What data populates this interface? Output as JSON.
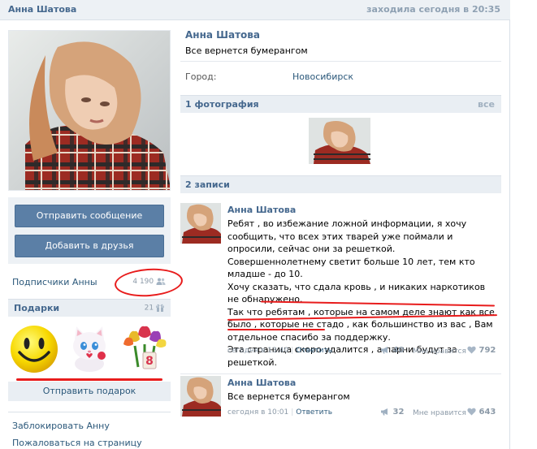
{
  "topbar": {
    "name": "Анна Шатова",
    "status": "заходила сегодня в 20:35"
  },
  "profile": {
    "name": "Анна Шатова",
    "status": "Все вернется бумерангом",
    "city_label": "Город:",
    "city_value": "Новосибирск"
  },
  "actions": {
    "send_message": "Отправить сообщение",
    "add_friend": "Добавить в друзья"
  },
  "followers": {
    "label": "Подписчики Анны",
    "count": "4 190"
  },
  "gifts": {
    "title": "Подарки",
    "count": "21",
    "send_gift": "Отправить подарок",
    "items": [
      "smiley-gift",
      "kitten-gift",
      "tulips-gift"
    ]
  },
  "links": {
    "block": "Заблокировать Анну",
    "report": "Пожаловаться на страницу"
  },
  "photos": {
    "title": "1 фотография",
    "all": "все"
  },
  "wall": {
    "title": "2 записи",
    "posts": [
      {
        "author": "Анна Шатова",
        "lines": [
          "Ребят , во избежание ложной информации, я хочу сообщить, что всех этих тварей уже поймали и опросили, сейчас они за решеткой. Совершеннолетнему светит больше 10 лет, тем кто младше - до 10.",
          "Хочу сказать, что сдала кровь , и никаких наркотиков не обнаружено.",
          "Так что ребятам , которые на самом деле знают как все было , которые не стадо , как большинство из вас , Вам отдельное спасибо за поддержку.",
          "Эта страница скоро удалится , а парни будут за решеткой."
        ],
        "time": "сегодня в 13:40",
        "reply": "Ответить",
        "shares": "40",
        "likes_label": "Мне нравится",
        "likes": "792"
      },
      {
        "author": "Анна Шатова",
        "lines": [
          "Все вернется бумерангом"
        ],
        "time": "сегодня в 10:01",
        "reply": "Ответить",
        "shares": "32",
        "likes_label": "Мне нравится",
        "likes": "643"
      }
    ]
  },
  "colors": {
    "link": "#2b587a",
    "header": "#45688e",
    "button": "#5b7fa6",
    "annotation": "#e81c1c"
  }
}
